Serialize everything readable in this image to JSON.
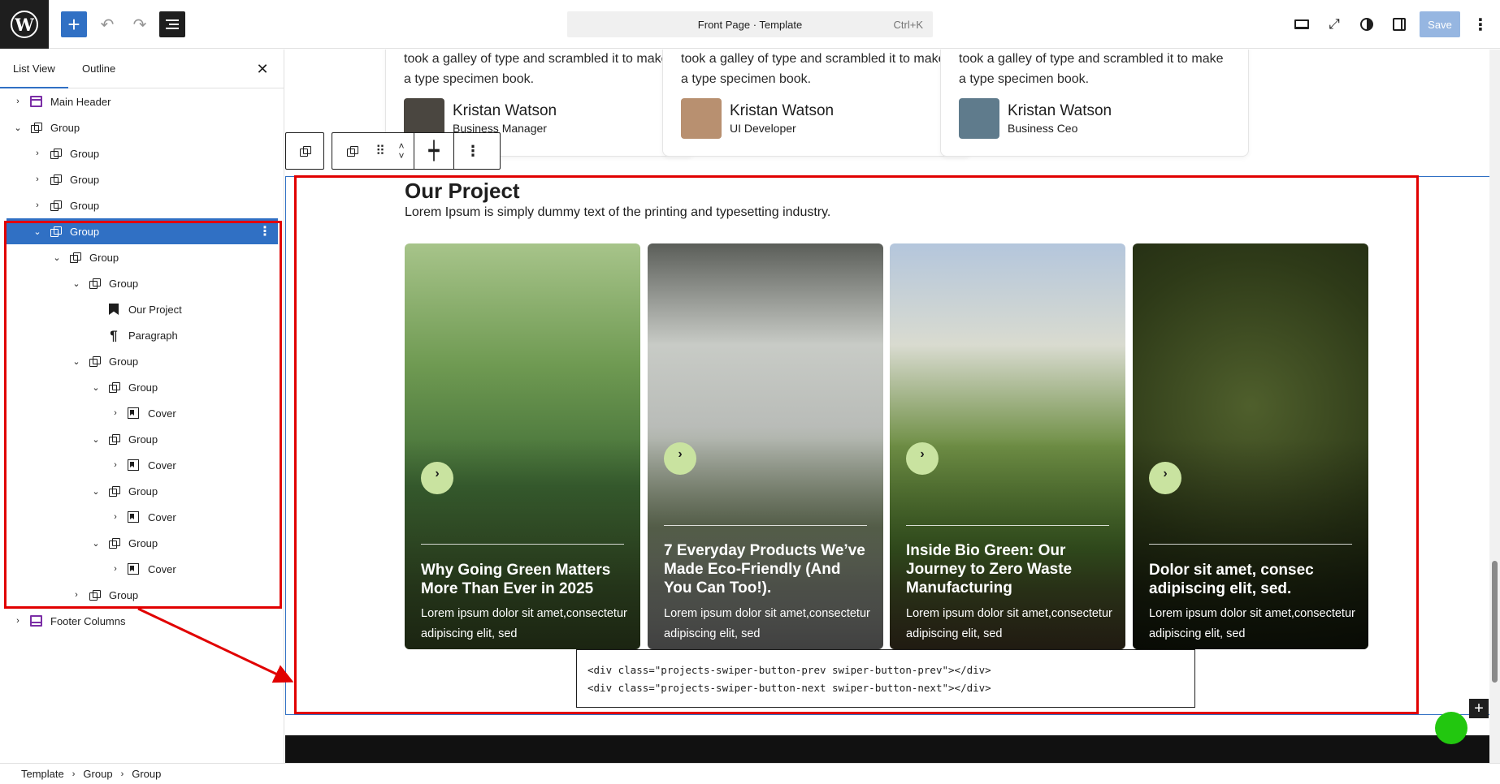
{
  "topbar": {
    "doc_title": "Front Page · Template",
    "shortcut": "Ctrl+K",
    "save_label": "Save"
  },
  "sidebar": {
    "tabs": [
      "List View",
      "Outline"
    ],
    "close_glyph": "✕",
    "tree": [
      {
        "label": "Main Header",
        "icon": "header-icon",
        "chevron": "›",
        "level": 0
      },
      {
        "label": "Group",
        "icon": "group-icon",
        "chevron": "⌄",
        "level": 0
      },
      {
        "label": "Group",
        "icon": "group-icon",
        "chevron": "›",
        "level": 1
      },
      {
        "label": "Group",
        "icon": "group-icon",
        "chevron": "›",
        "level": 1
      },
      {
        "label": "Group",
        "icon": "group-icon",
        "chevron": "›",
        "level": 1
      },
      {
        "label": "Group",
        "icon": "group-icon",
        "chevron": "⌄",
        "level": 1,
        "selected": true
      },
      {
        "label": "Group",
        "icon": "group-icon",
        "chevron": "⌄",
        "level": 2
      },
      {
        "label": "Group",
        "icon": "group-icon",
        "chevron": "⌄",
        "level": 3
      },
      {
        "label": "Our Project",
        "icon": "heading-icon",
        "chevron": "",
        "level": 4
      },
      {
        "label": "Paragraph",
        "icon": "paragraph-icon",
        "chevron": "",
        "level": 4
      },
      {
        "label": "Group",
        "icon": "group-icon",
        "chevron": "⌄",
        "level": 3
      },
      {
        "label": "Group",
        "icon": "group-icon",
        "chevron": "⌄",
        "level": 4
      },
      {
        "label": "Cover",
        "icon": "cover-icon",
        "chevron": "›",
        "level": 5
      },
      {
        "label": "Group",
        "icon": "group-icon",
        "chevron": "⌄",
        "level": 4
      },
      {
        "label": "Cover",
        "icon": "cover-icon",
        "chevron": "›",
        "level": 5
      },
      {
        "label": "Group",
        "icon": "group-icon",
        "chevron": "⌄",
        "level": 4
      },
      {
        "label": "Cover",
        "icon": "cover-icon",
        "chevron": "›",
        "level": 5
      },
      {
        "label": "Group",
        "icon": "group-icon",
        "chevron": "⌄",
        "level": 4
      },
      {
        "label": "Cover",
        "icon": "cover-icon",
        "chevron": "›",
        "level": 5
      },
      {
        "label": "Group",
        "icon": "group-icon",
        "chevron": "›",
        "level": 3
      },
      {
        "label": "Footer Columns",
        "icon": "footer-icon",
        "chevron": "›",
        "level": 0
      }
    ]
  },
  "breadcrumb": [
    "Template",
    "Group",
    "Group"
  ],
  "testimonials": [
    {
      "text": "took a galley of type and scrambled it to make a type specimen book.",
      "name": "Kristan Watson",
      "role": "Business Manager",
      "avatar_color": "#4a4640"
    },
    {
      "text": "took a galley of type and scrambled it to make a type specimen book.",
      "name": "Kristan Watson",
      "role": "UI Developer",
      "avatar_color": "#b89070"
    },
    {
      "text": "took a galley of type and scrambled it to make a type specimen book.",
      "name": "Kristan Watson",
      "role": "Business Ceo",
      "avatar_color": "#5f7b8c"
    }
  ],
  "project": {
    "title": "Our Project",
    "subtitle": "Lorem Ipsum is simply dummy text of the printing and typesetting industry.",
    "cards": [
      {
        "title": "Why Going Green Matters More Than Ever in 2025",
        "desc": "Lorem ipsum dolor sit amet,consectetur adipiscing elit, sed",
        "arrow": "›",
        "bg": "linear-gradient(180deg,#a7c48a 0%,#6f9a52 30%,#3f6b35 60%,#5a7a3a 100%)"
      },
      {
        "title": "7 Everyday Products We’ve Made Eco-Friendly (And You Can Too!).",
        "desc": "Lorem ipsum dolor sit amet,consectetur adipiscing elit, sed",
        "arrow": "›",
        "bg": "linear-gradient(180deg,#5b5e59 0%,#c8cbc6 25%,#b9bcb8 45%,#7c8a6b 70%,#d8d8d8 100%)"
      },
      {
        "title": "Inside Bio Green: Our Journey to Zero Waste Manufacturing",
        "desc": "Lorem ipsum dolor sit amet,consectetur adipiscing elit, sed",
        "arrow": "›",
        "bg": "linear-gradient(180deg,#b4c6dc 0%,#d9dbd0 25%,#6f8f45 50%,#4f7a2e 75%,#6b5a3a 100%)"
      },
      {
        "title": "Dolor sit amet, consec adipiscing elit, sed.",
        "desc": "Lorem ipsum dolor sit amet,consectetur adipiscing elit, sed",
        "arrow": "›",
        "bg": "radial-gradient(circle at 50% 40%,#4f5f2c 0%,#2e3a18 55%,#1c2410 100%)"
      }
    ]
  },
  "code": "<div class=\"projects-swiper-button-prev swiper-button-prev\"></div>\n<div class=\"projects-swiper-button-next swiper-button-next\"></div>",
  "colors": {
    "accent": "#3070c4",
    "highlight": "#e10000",
    "arrow_bg": "#c9e3a0",
    "status_green": "#22c70f"
  }
}
